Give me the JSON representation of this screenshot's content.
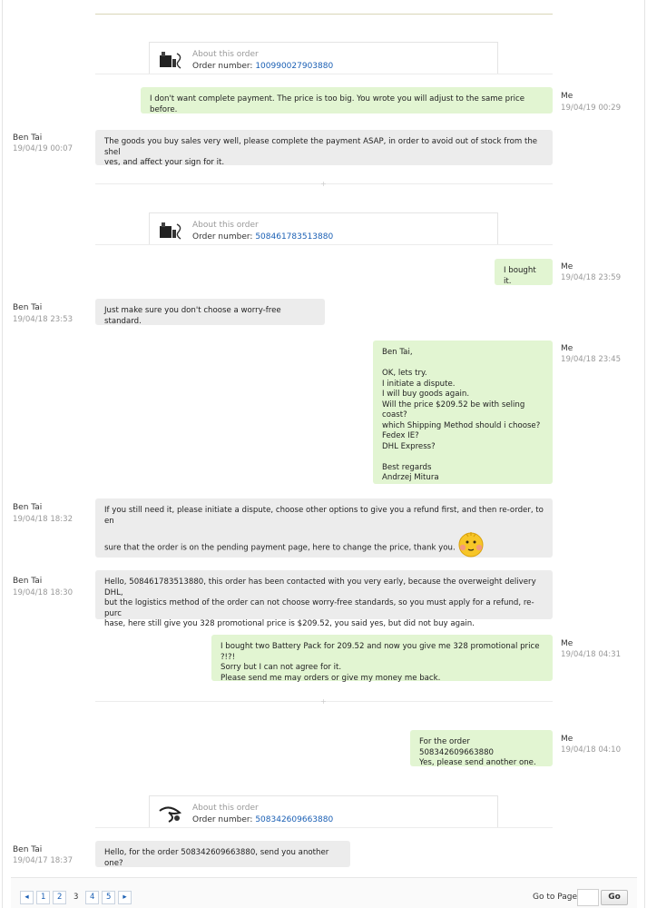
{
  "orders": [
    {
      "about_label": "About this order",
      "number_label": "Order number:",
      "number": "100990027903880"
    },
    {
      "about_label": "About this order",
      "number_label": "Order number:",
      "number": "508461783513880"
    },
    {
      "about_label": "About this order",
      "number_label": "Order number:",
      "number": "508342609663880"
    }
  ],
  "messages": [
    {
      "sender": "Me",
      "time": "19/04/19 00:29",
      "text": "I don't want complete payment. The price is too big. You wrote you will adjust to the same price before."
    },
    {
      "sender": "Ben Tai",
      "time": "19/04/19 00:07",
      "text": "The goods you buy sales very well, please complete the payment ASAP, in order to avoid out of stock from the shel\nves, and affect your sign for it."
    },
    {
      "sender": "Me",
      "time": "19/04/18 23:59",
      "text": "I bought it."
    },
    {
      "sender": "Ben Tai",
      "time": "19/04/18 23:53",
      "text": "Just make sure you don't choose a worry-free standard."
    },
    {
      "sender": "Me",
      "time": "19/04/18 23:45",
      "text": "Ben Tai,\n\nOK, lets try.\nI initiate a dispute.\nI will buy goods again.\nWill the price $209.52 be with seling coast?\nwhich Shipping Method should i choose?\nFedex IE?\nDHL Express?\n\nBest regards\nAndrzej Mitura"
    },
    {
      "sender": "Ben Tai",
      "time": "19/04/18 18:32",
      "text": "If you still need it, please initiate a dispute, choose other options to give you a refund first, and then re-order, to en\n\nsure that the order is on the pending payment page, here to change the price, thank you."
    },
    {
      "sender": "Ben Tai",
      "time": "19/04/18 18:30",
      "text": "Hello, 508461783513880, this order has been contacted with you very early, because the overweight delivery DHL,\nbut the logistics method of the order can not choose worry-free standards, so you must apply for a refund, re-purc\nhase, here still give you 328 promotional price is $209.52, you said yes, but did not buy again."
    },
    {
      "sender": "Me",
      "time": "19/04/18 04:31",
      "text": "I bought two Battery Pack for 209.52 and now you give me 328 promotional price ?!?!\nSorry but I can not agree for it.\nPlease send me may orders or give my money me back."
    },
    {
      "sender": "Me",
      "time": "19/04/18 04:10",
      "text": "For the order 508342609663880\nYes, please send another one."
    },
    {
      "sender": "Ben Tai",
      "time": "19/04/17 18:37",
      "text": "Hello, for the order 508342609663880, send you another one?"
    }
  ],
  "pagination": {
    "prev": "◂",
    "pages": [
      "1",
      "2",
      "3",
      "4",
      "5"
    ],
    "current": "3",
    "next": "▸",
    "goto_label": "Go to Page",
    "goto_value": "",
    "go_button": "Go"
  },
  "colors": {
    "me_bubble": "#e2f5d2",
    "them_bubble": "#ececec",
    "link": "#1a5fb4"
  },
  "icons": {
    "divider": "plus-ornament-icon",
    "emoji": "smiley-emoji-icon"
  }
}
